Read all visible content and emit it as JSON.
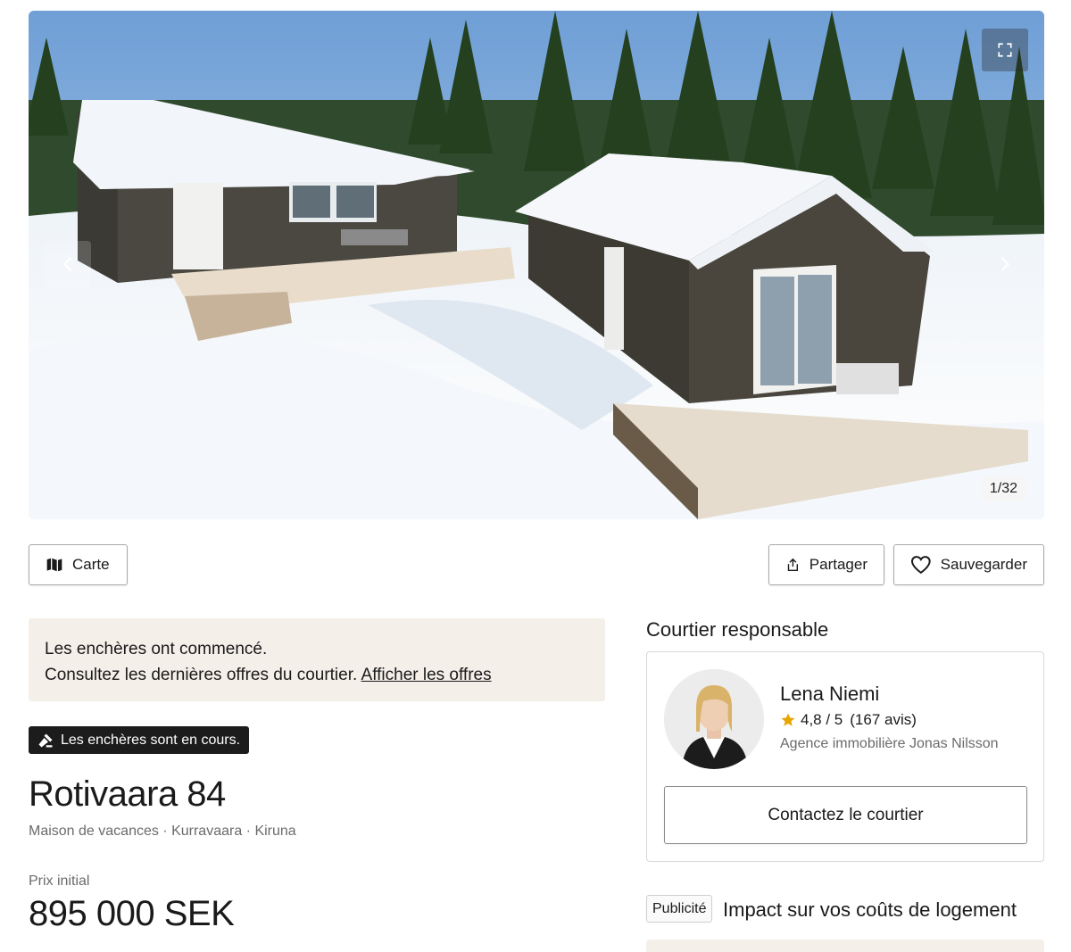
{
  "gallery": {
    "counter": "1/32",
    "prev_icon": "chevron-left-icon",
    "next_icon": "chevron-right-icon",
    "fullscreen_icon": "fullscreen-icon"
  },
  "actions": {
    "map_label": "Carte",
    "share_label": "Partager",
    "save_label": "Sauvegarder"
  },
  "bidding": {
    "line1": "Les enchères ont commencé.",
    "line2": "Consultez les dernières offres du courtier.",
    "link": "Afficher les offres",
    "badge": "Les enchères sont en cours."
  },
  "listing": {
    "title": "Rotivaara 84",
    "subtitle": "Maison de vacances · Kurravaara · Kiruna",
    "price_label": "Prix initial",
    "price": "895 000 SEK"
  },
  "agent": {
    "heading": "Courtier responsable",
    "name": "Lena Niemi",
    "rating": "4,8 / 5",
    "reviews": "(167 avis)",
    "agency": "Agence immobilière Jonas Nilsson",
    "contact_label": "Contactez le courtier"
  },
  "ad": {
    "badge": "Publicité",
    "title": "Impact sur vos coûts de logement"
  },
  "colors": {
    "banner_bg": "#f5efea",
    "badge_bg": "#1c1c1c",
    "star": "#e8a500",
    "muted_text": "#6b6b6b"
  }
}
